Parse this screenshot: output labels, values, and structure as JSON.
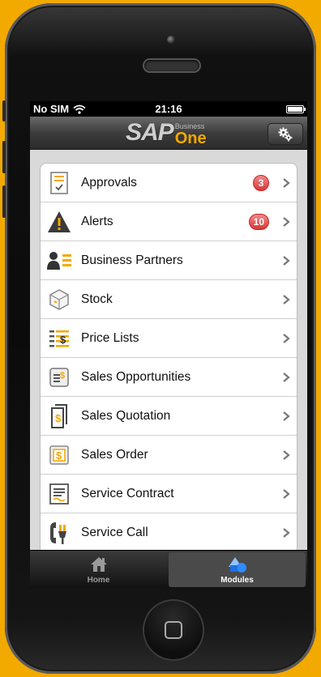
{
  "status": {
    "carrier": "No SIM",
    "time": "21:16"
  },
  "header": {
    "logo_sap": "SAP",
    "logo_business": "Business",
    "logo_one": "One"
  },
  "menu": [
    {
      "label": "Approvals",
      "badge": "3",
      "icon": "approvals-icon"
    },
    {
      "label": "Alerts",
      "badge": "10",
      "icon": "alert-icon"
    },
    {
      "label": "Business Partners",
      "badge": "",
      "icon": "business-partners-icon"
    },
    {
      "label": "Stock",
      "badge": "",
      "icon": "stock-icon"
    },
    {
      "label": "Price Lists",
      "badge": "",
      "icon": "price-lists-icon"
    },
    {
      "label": "Sales Opportunities",
      "badge": "",
      "icon": "sales-opportunities-icon"
    },
    {
      "label": "Sales Quotation",
      "badge": "",
      "icon": "sales-quotation-icon"
    },
    {
      "label": "Sales Order",
      "badge": "",
      "icon": "sales-order-icon"
    },
    {
      "label": "Service Contract",
      "badge": "",
      "icon": "service-contract-icon"
    },
    {
      "label": "Service Call",
      "badge": "",
      "icon": "service-call-icon"
    }
  ],
  "tabs": [
    {
      "label": "Home",
      "icon": "home-icon",
      "active": false
    },
    {
      "label": "Modules",
      "icon": "modules-icon",
      "active": true
    }
  ],
  "colors": {
    "brand": "#f2a900",
    "badge": "#d43a3a"
  }
}
